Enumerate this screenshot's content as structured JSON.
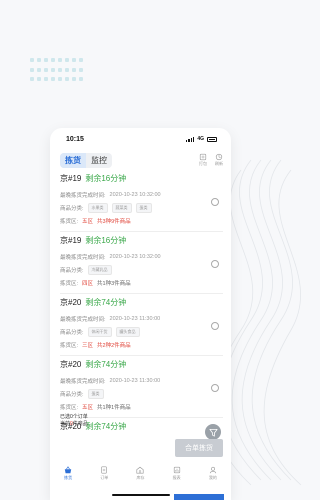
{
  "colors": {
    "accent": "#2d6fd6",
    "green": "#3aa84a",
    "red": "#e0453a"
  },
  "statusbar": {
    "time": "10:15",
    "network": "4G"
  },
  "nav": {
    "tabs": [
      {
        "label": "拣货"
      },
      {
        "label": "监控"
      }
    ],
    "icons": [
      {
        "label": "打包",
        "icon": "package-icon"
      },
      {
        "label": "刷新",
        "icon": "refresh-icon"
      }
    ]
  },
  "labels": {
    "deadline": "最晚拣货完成时间:",
    "category": "商品分类:",
    "zone": "拣货区:"
  },
  "orders": [
    {
      "order": "京#19",
      "remain": "剩余16分钟",
      "deadline": "2020-10-23 10:32:00",
      "tags": [
        "水果类",
        "蔬菜类",
        "蛋类"
      ],
      "zone": "五区",
      "summary": "共3种9件商品"
    },
    {
      "order": "京#19",
      "remain": "剩余16分钟",
      "deadline": "2020-10-23 10:32:00",
      "tags": [
        "冷藏乳品"
      ],
      "zone": "四区",
      "summary": "共1种3件商品"
    },
    {
      "order": "京#20",
      "remain": "剩余74分钟",
      "deadline": "2020-10-23 11:30:00",
      "tags": [
        "休闲干货",
        "罐头食品"
      ],
      "zone": "三区",
      "summary": "共2种2件商品"
    },
    {
      "order": "京#20",
      "remain": "剩余74分钟",
      "deadline": "2020-10-23 11:30:00",
      "tags": [
        "蛋类"
      ],
      "zone": "五区",
      "summary": "共1种1件商品"
    },
    {
      "order": "京#20",
      "remain": "剩余74分钟"
    }
  ],
  "footer": {
    "selected": "已选0个订单",
    "sub_prefix": "当前",
    "sub_zero": "0",
    "sub_suffix": "件商品",
    "gather_button": "合单拣货"
  },
  "tabbar": [
    {
      "label": "拣货",
      "icon": "basket-icon"
    },
    {
      "label": "订单",
      "icon": "document-icon"
    },
    {
      "label": "库存",
      "icon": "warehouse-icon"
    },
    {
      "label": "报表",
      "icon": "chart-icon"
    },
    {
      "label": "我的",
      "icon": "user-icon"
    }
  ]
}
